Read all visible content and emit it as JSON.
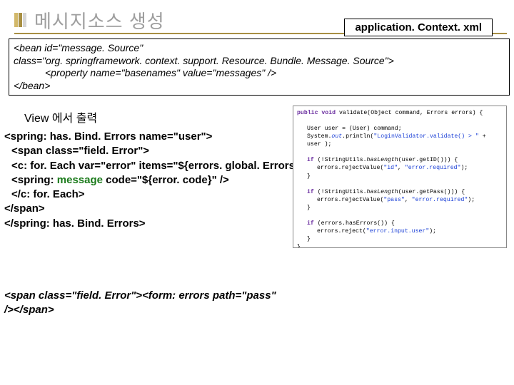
{
  "title": "메시지소스 생성",
  "badge": "application. Context. xml",
  "xml": {
    "l1": "<bean id=\"message. Source\"",
    "l2": "class=\"org. springframework. context. support. Resource. Bundle. Message. Source\">",
    "l3": "<property name=\"basenames\" value=\"messages\" />",
    "l4": "</bean>"
  },
  "view_label": "View 에서 출력",
  "jsp": {
    "a": "<spring: has. Bind. Errors name=\"user\">",
    "b": " <span class=\"field. Error\">",
    "c": " <c: for. Each var=\"error\" items=\"${errors. global. Errors}\">",
    "d_pre": "   <spring: ",
    "d_kw": "message",
    "d_post": " code=\"${error. code}\"  />",
    "e": " </c: for. Each>",
    "f": " </span>",
    "g": " </spring: has. Bind. Errors>"
  },
  "java": {
    "l1a": "public void ",
    "l1b": "validate(Object command, Errors errors) {",
    "l2": "User user = (User) command;",
    "l3a": "System.",
    "l3b": "out",
    "l3c": ".println(",
    "l3d": "\"LoginValidator.validate() > \"",
    "l3e": " + user );",
    "l4a": "if",
    "l4b": " (!StringUtils.",
    "l4c": "hasLength",
    "l4d": "(user.getID())) {",
    "l5a": "errors.rejectValue(",
    "l5b": "\"id\"",
    "l5c": ", ",
    "l5d": "\"error.required\"",
    "l5e": ");",
    "l6": "}",
    "l7a": "if",
    "l7b": " (!StringUtils.",
    "l7c": "hasLength",
    "l7d": "(user.getPass())) {",
    "l8a": "errors.rejectValue(",
    "l8b": "\"pass\"",
    "l8c": ", ",
    "l8d": "\"error.required\"",
    "l8e": ");",
    "l9": "}",
    "l10a": "if",
    "l10b": " (errors.hasErrors()) {",
    "l11a": "errors.reject(",
    "l11b": "\"error.input.user\"",
    "l11c": ");",
    "l12": "}",
    "l13": "}"
  },
  "form": {
    "l1": " <span class=\"field. Error\"><form: errors path=\"pass\"",
    "l2": "/></span>"
  }
}
